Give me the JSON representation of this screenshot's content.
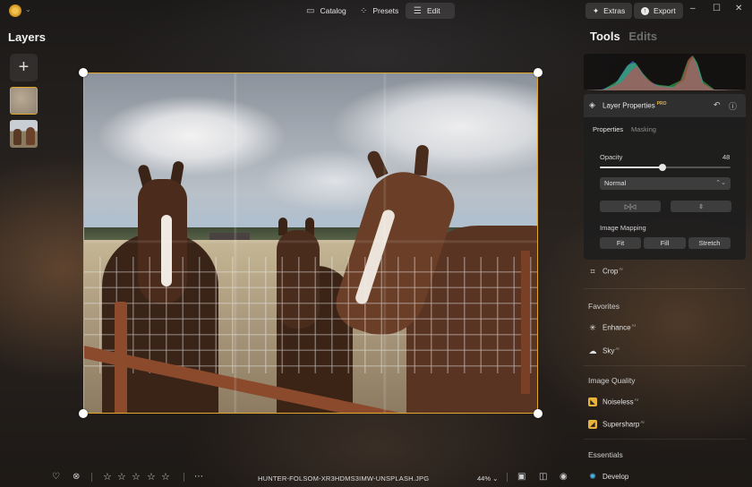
{
  "topbar": {
    "nav": [
      {
        "label": "Catalog",
        "icon": "folder-icon"
      },
      {
        "label": "Presets",
        "icon": "presets-icon"
      },
      {
        "label": "Edit",
        "icon": "sliders-icon",
        "active": true
      }
    ],
    "extras_label": "Extras",
    "export_label": "Export"
  },
  "layers_panel": {
    "title": "Layers",
    "add_label": "+"
  },
  "canvas": {
    "filename": "HUNTER-FOLSOM-XR3HDMS3IMW-UNSPLASH.JPG",
    "zoom": "44%"
  },
  "right_panel": {
    "tabs": [
      "Tools",
      "Edits"
    ],
    "layer_properties": {
      "title": "Layer Properties",
      "badge": "PRO",
      "subtabs": [
        "Properties",
        "Masking"
      ],
      "opacity_label": "Opacity",
      "opacity_value": "48",
      "opacity_fraction": 0.48,
      "blend_mode": "Normal",
      "image_mapping_label": "Image Mapping",
      "mapping_options": [
        "Fit",
        "Fill",
        "Stretch"
      ]
    },
    "crop_label": "Crop",
    "ai_badge": "AI",
    "sections": {
      "favorites": "Favorites",
      "favorites_items": [
        "Enhance",
        "Sky"
      ],
      "image_quality": "Image Quality",
      "image_quality_items": [
        "Noiseless",
        "Supersharp"
      ],
      "essentials": "Essentials",
      "essentials_items": [
        "Develop"
      ]
    }
  },
  "bottom": {
    "rating_stars": 5,
    "rating_value": 0
  },
  "colors": {
    "accent": "#e3a82b",
    "pro_badge": "#e6b43a"
  }
}
